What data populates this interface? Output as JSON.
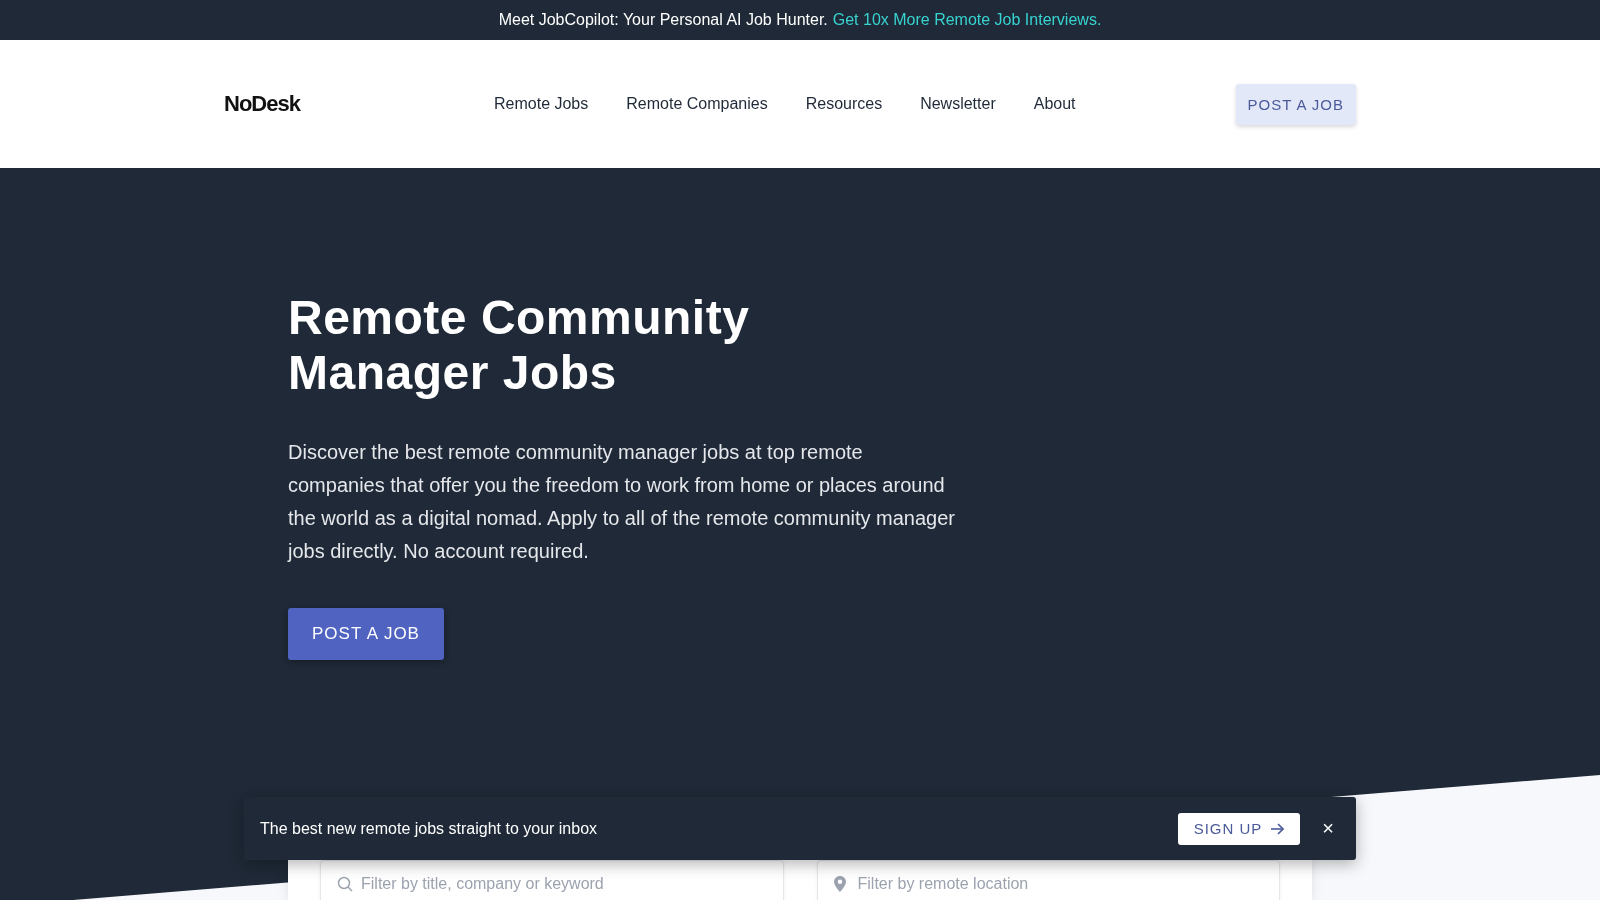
{
  "announcement": {
    "text": "Meet JobCopilot: Your Personal AI Job Hunter.",
    "link": "Get 10x More Remote Job Interviews."
  },
  "header": {
    "logo": "NoDesk",
    "nav": [
      "Remote Jobs",
      "Remote Companies",
      "Resources",
      "Newsletter",
      "About"
    ],
    "cta": "POST A JOB"
  },
  "hero": {
    "title": "Remote Community Manager Jobs",
    "description": "Discover the best remote community manager jobs at top remote companies that offer you the freedom to work from home or places around the world as a digital nomad. Apply to all of the remote community manager jobs directly. No account required.",
    "button": "POST A JOB"
  },
  "filters": [
    {
      "kind": "search",
      "placeholder": "Filter by title, company or keyword"
    },
    {
      "kind": "location",
      "placeholder": "Filter by remote location"
    }
  ],
  "newsletter_banner": {
    "text": "The best new remote jobs straight to your inbox",
    "button": "SIGN UP",
    "close": "×"
  }
}
